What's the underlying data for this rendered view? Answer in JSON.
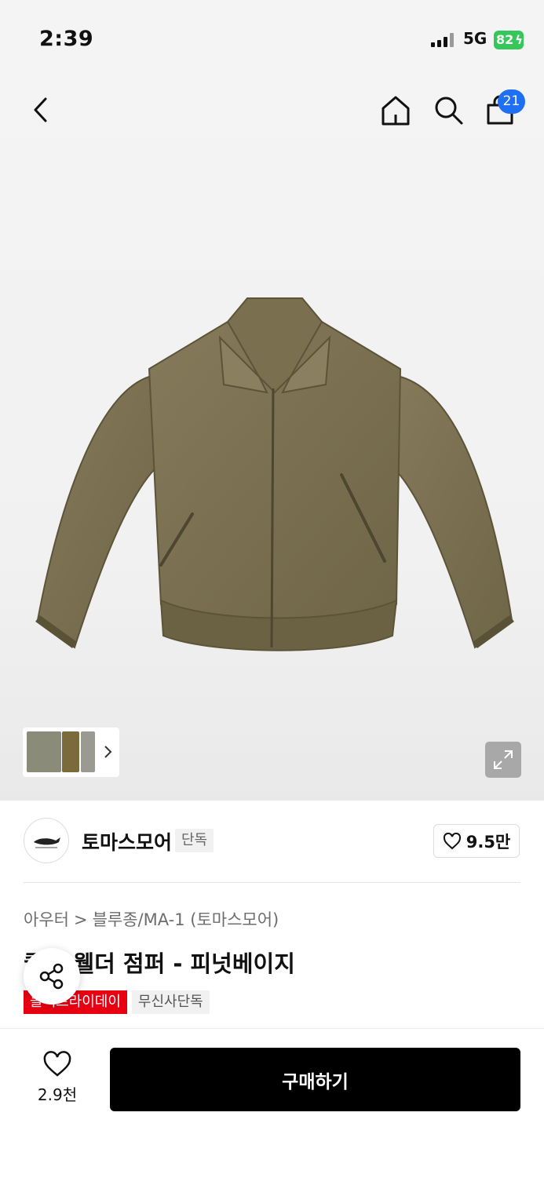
{
  "status_bar": {
    "time": "2:39",
    "network": "5G",
    "battery": "82"
  },
  "header": {
    "cart_count": "21"
  },
  "gallery": {
    "thumbnail_count": 3
  },
  "brand": {
    "name": "토마스모어",
    "tag": "단독",
    "likes": "9.5만"
  },
  "breadcrumb": {
    "level1": "아우터",
    "separator": ">",
    "level2": "블루종/MA-1 (토마스모어)"
  },
  "product": {
    "title": "퀼팅 웰더 점퍼 - 피넛베이지",
    "tags": [
      "블랙프라이데이",
      "무신사단독"
    ]
  },
  "bottom_bar": {
    "wish_count": "2.9천",
    "buy_label": "구매하기"
  },
  "colors": {
    "sale_red": "#e60012",
    "badge_blue": "#1f6ff2",
    "battery_green": "#35c759",
    "jacket_olive": "#7d7354"
  }
}
